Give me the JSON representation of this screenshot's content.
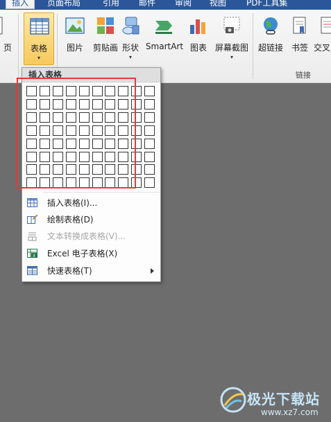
{
  "ribbon_tabs": {
    "insert": "插入",
    "page_layout": "页面布局",
    "references": "引用",
    "mailings": "邮件",
    "review": "审阅",
    "view": "视图",
    "pdf_tools": "PDF工具集"
  },
  "ribbon_buttons": {
    "cover_page": "页",
    "table": "表格",
    "picture": "图片",
    "clip_art": "剪贴画",
    "shapes": "形状",
    "smartart": "SmartArt",
    "chart": "图表",
    "screenshot": "屏幕截图",
    "hyperlink": "超链接",
    "bookmark": "书签",
    "cross_reference": "交叉"
  },
  "ribbon_groups": {
    "links": "链接"
  },
  "table_menu": {
    "header": "插入表格",
    "grid_rows": 8,
    "grid_cols": 10,
    "items": [
      {
        "label": "插入表格(I)...",
        "icon": "table-icon",
        "enabled": true
      },
      {
        "label": "绘制表格(D)",
        "icon": "pencil-table-icon",
        "enabled": true
      },
      {
        "label": "文本转换成表格(V)...",
        "icon": "text-to-table-icon",
        "enabled": false
      },
      {
        "label": "Excel 电子表格(X)",
        "icon": "excel-icon",
        "enabled": true
      },
      {
        "label": "快速表格(T)",
        "icon": "quick-table-icon",
        "enabled": true,
        "submenu": true
      }
    ]
  },
  "watermark": {
    "name": "极光下载站",
    "url": "www.xz7.com"
  },
  "colors": {
    "accent": "#2b579a",
    "highlight_box": "#e23a3a",
    "pressed_button": "#f7c95c"
  }
}
